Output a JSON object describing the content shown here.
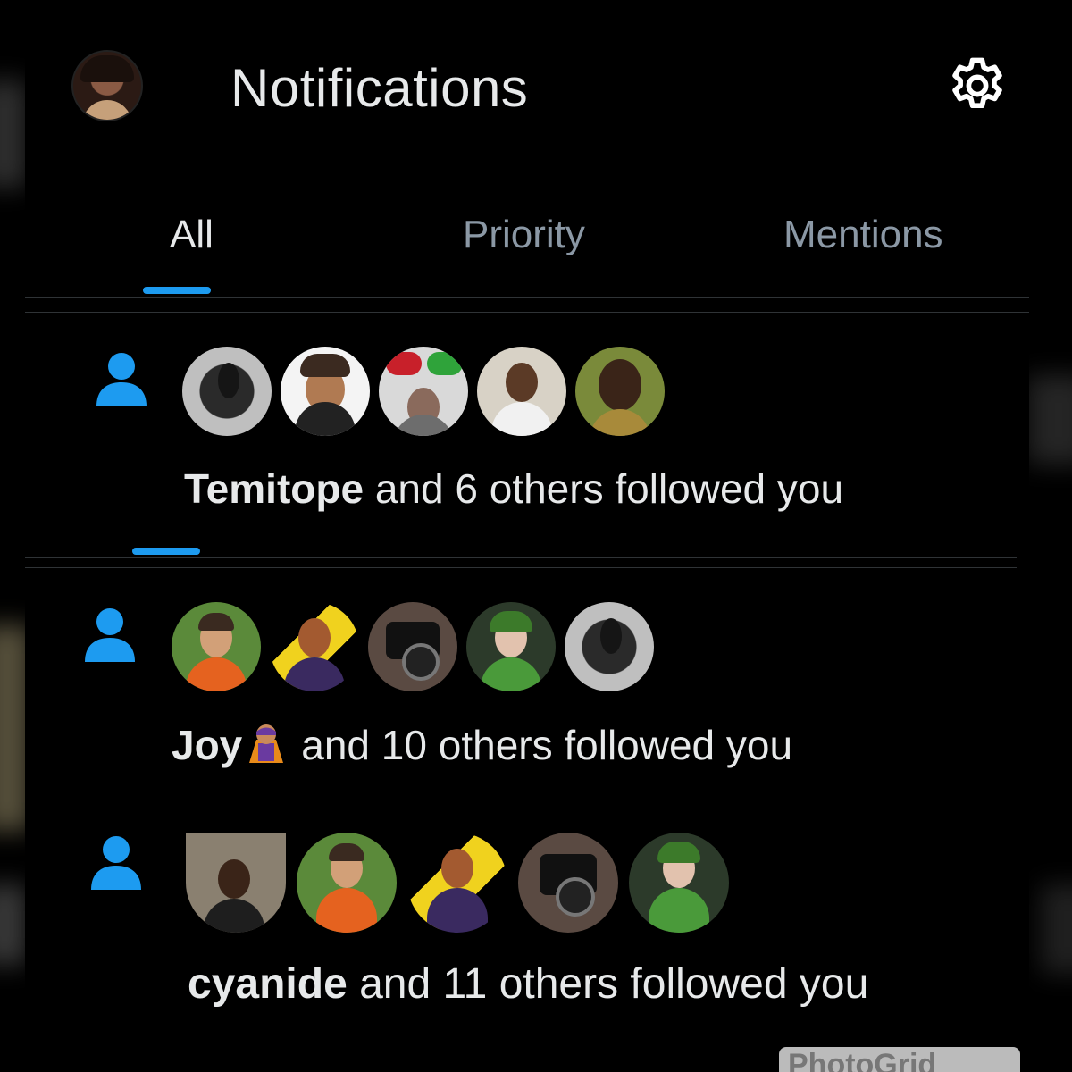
{
  "header": {
    "title": "Notifications",
    "profile_avatar_icon": "profile-avatar",
    "settings_icon": "gear-icon"
  },
  "tabs": [
    {
      "label": "All",
      "active": true
    },
    {
      "label": "Priority",
      "active": false
    },
    {
      "label": "Mentions",
      "active": false
    }
  ],
  "notifications": [
    {
      "icon": "person-icon",
      "actor": "Temitope",
      "rest": " and 6 others followed you",
      "avatar_count": 5
    },
    {
      "icon": "person-icon",
      "actor": "Joy",
      "actor_emoji": "superhero-emoji",
      "rest": "and 10 others followed you",
      "avatar_count": 5
    },
    {
      "icon": "person-icon",
      "actor": "cyanide",
      "rest": " and 11 others followed you",
      "avatar_count": 5
    }
  ],
  "colors": {
    "background": "#000000",
    "accent": "#1d9bf0",
    "text_primary": "#e7e9ea",
    "text_secondary": "#8b98a5",
    "divider": "#2f3336"
  },
  "watermark": "PhotoGrid"
}
